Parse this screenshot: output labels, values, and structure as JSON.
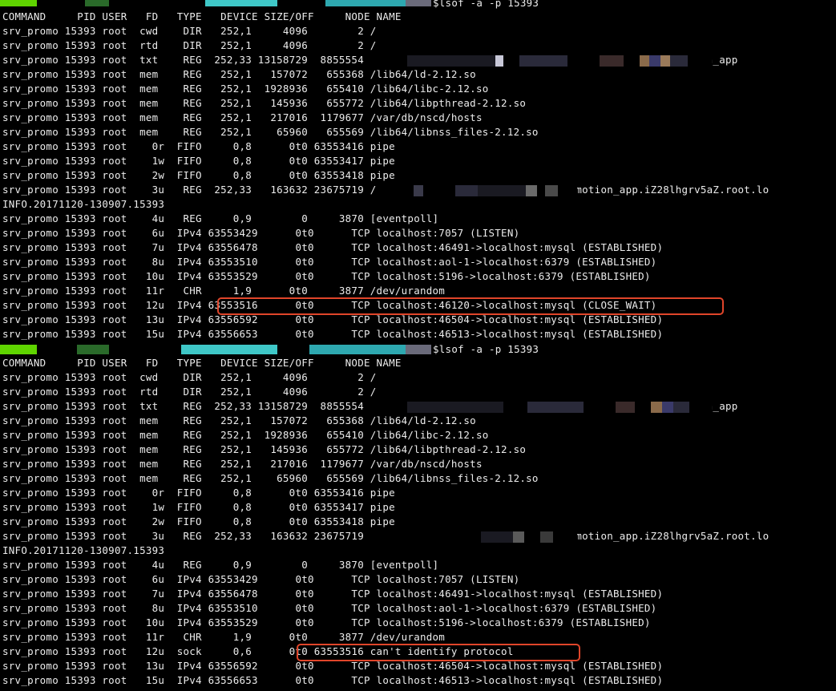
{
  "terminal": {
    "colors": {
      "background": "#000000",
      "text": "#ececec",
      "highlight_box": "#e0452a"
    },
    "blocks": [
      {
        "prompt": "$lsof -a -p 15393",
        "header": "COMMAND     PID USER   FD   TYPE   DEVICE SIZE/OFF     NODE NAME",
        "rows": [
          "srv_promo 15393 root  cwd    DIR   252,1     4096        2 /",
          "srv_promo 15393 root  rtd    DIR   252,1     4096        2 /",
          "srv_promo 15393 root  txt    REG  252,33 13158729  8855554                                          /srv_promotion_app",
          "srv_promo 15393 root  mem    REG   252,1   157072   655368 /lib64/ld-2.12.so",
          "srv_promo 15393 root  mem    REG   252,1  1928936   655410 /lib64/libc-2.12.so",
          "srv_promo 15393 root  mem    REG   252,1   145936   655772 /lib64/libpthread-2.12.so",
          "srv_promo 15393 root  mem    REG   252,1   217016  1179677 /var/db/nscd/hosts",
          "srv_promo 15393 root  mem    REG   252,1    65960   655569 /lib64/libnss_files-2.12.so",
          "srv_promo 15393 root    0r  FIFO     0,8      0t0 63553416 pipe",
          "srv_promo 15393 root    1w  FIFO     0,8      0t0 63553417 pipe",
          "srv_promo 15393 root    2w  FIFO     0,8      0t0 63553418 pipe",
          "srv_promo 15393 root    3u   REG  252,33   163632 23675719 /                        /srv_promotion_app.iZ28lhgrv5aZ.root.lo",
          "INFO.20171120-130907.15393",
          "srv_promo 15393 root    4u   REG     0,9        0     3870 [eventpoll]",
          "srv_promo 15393 root    6u  IPv4 63553429      0t0      TCP localhost:7057 (LISTEN)",
          "srv_promo 15393 root    7u  IPv4 63556478      0t0      TCP localhost:46491->localhost:mysql (ESTABLISHED)",
          "srv_promo 15393 root    8u  IPv4 63553510      0t0      TCP localhost:aol-1->localhost:6379 (ESTABLISHED)",
          "srv_promo 15393 root   10u  IPv4 63553529      0t0      TCP localhost:5196->localhost:6379 (ESTABLISHED)",
          "srv_promo 15393 root   11r   CHR     1,9      0t0     3877 /dev/urandom",
          "srv_promo 15393 root   12u  IPv4 63553516      0t0      TCP localhost:46120->localhost:mysql (CLOSE_WAIT)",
          "srv_promo 15393 root   13u  IPv4 63556592      0t0      TCP localhost:46504->localhost:mysql (ESTABLISHED)",
          "srv_promo 15393 root   15u  IPv4 63556653      0t0      TCP localhost:46513->localhost:mysql (ESTABLISHED)"
        ]
      },
      {
        "prompt": "$lsof -a -p 15393",
        "header": "COMMAND     PID USER   FD   TYPE   DEVICE SIZE/OFF     NODE NAME",
        "rows": [
          "srv_promo 15393 root  cwd    DIR   252,1     4096        2 /",
          "srv_promo 15393 root  rtd    DIR   252,1     4096        2 /",
          "srv_promo 15393 root  txt    REG  252,33 13158729  8855554                                          /srv_promotion_app",
          "srv_promo 15393 root  mem    REG   252,1   157072   655368 /lib64/ld-2.12.so",
          "srv_promo 15393 root  mem    REG   252,1  1928936   655410 /lib64/libc-2.12.so",
          "srv_promo 15393 root  mem    REG   252,1   145936   655772 /lib64/libpthread-2.12.so",
          "srv_promo 15393 root  mem    REG   252,1   217016  1179677 /var/db/nscd/hosts",
          "srv_promo 15393 root  mem    REG   252,1    65960   655569 /lib64/libnss_files-2.12.so",
          "srv_promo 15393 root    0r  FIFO     0,8      0t0 63553416 pipe",
          "srv_promo 15393 root    1w  FIFO     0,8      0t0 63553417 pipe",
          "srv_promo 15393 root    2w  FIFO     0,8      0t0 63553418 pipe",
          "srv_promo 15393 root    3u   REG  252,33   163632 23675719                          /srv_promotion_app.iZ28lhgrv5aZ.root.lo",
          "INFO.20171120-130907.15393",
          "srv_promo 15393 root    4u   REG     0,9        0     3870 [eventpoll]",
          "srv_promo 15393 root    6u  IPv4 63553429      0t0      TCP localhost:7057 (LISTEN)",
          "srv_promo 15393 root    7u  IPv4 63556478      0t0      TCP localhost:46491->localhost:mysql (ESTABLISHED)",
          "srv_promo 15393 root    8u  IPv4 63553510      0t0      TCP localhost:aol-1->localhost:6379 (ESTABLISHED)",
          "srv_promo 15393 root   10u  IPv4 63553529      0t0      TCP localhost:5196->localhost:6379 (ESTABLISHED)",
          "srv_promo 15393 root   11r   CHR     1,9      0t0     3877 /dev/urandom",
          "srv_promo 15393 root   12u  sock     0,6      0t0 63553516 can't identify protocol",
          "srv_promo 15393 root   13u  IPv4 63556592      0t0      TCP localhost:46504->localhost:mysql (ESTABLISHED)",
          "srv_promo 15393 root   15u  IPv4 63556653      0t0      TCP localhost:46513->localhost:mysql (ESTABLISHED)"
        ]
      }
    ]
  }
}
